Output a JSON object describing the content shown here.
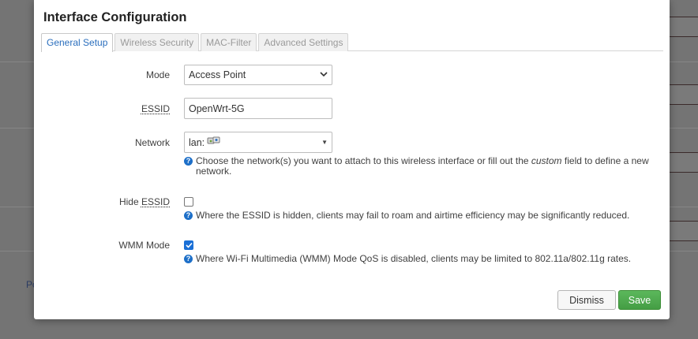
{
  "background": {
    "link_text": "Po"
  },
  "modal": {
    "title": "Interface Configuration",
    "tabs": [
      {
        "label": "General Setup",
        "active": true
      },
      {
        "label": "Wireless Security",
        "active": false
      },
      {
        "label": "MAC-Filter",
        "active": false
      },
      {
        "label": "Advanced Settings",
        "active": false
      }
    ],
    "fields": {
      "mode": {
        "label": "Mode",
        "value": "Access Point"
      },
      "essid": {
        "label": "ESSID",
        "value": "OpenWrt-5G"
      },
      "network": {
        "label": "Network",
        "value": "lan:",
        "help_pre": "Choose the network(s) you want to attach to this wireless interface or fill out the ",
        "help_em": "custom",
        "help_post": " field to define a new network."
      },
      "hide_essid": {
        "label_prefix": "Hide ",
        "label_abbr": "ESSID",
        "checked": false,
        "help": "Where the ESSID is hidden, clients may fail to roam and airtime efficiency may be significantly reduced."
      },
      "wmm_mode": {
        "label": "WMM Mode",
        "checked": true,
        "help": "Where Wi-Fi Multimedia (WMM) Mode QoS is disabled, clients may be limited to 802.11a/802.11g rates."
      }
    },
    "buttons": {
      "dismiss": "Dismiss",
      "save": "Save"
    }
  },
  "colors": {
    "active_tab": "#2a6ebd",
    "save_button": "#4cae4c",
    "help_icon": "#1d6fc8",
    "checkbox_checked": "#1a6fd6"
  },
  "icons": {
    "help": "help-circle-icon",
    "network_interface": "network-interface-icon",
    "dropdown": "chevron-down-icon",
    "checkmark": "checkmark-icon"
  }
}
